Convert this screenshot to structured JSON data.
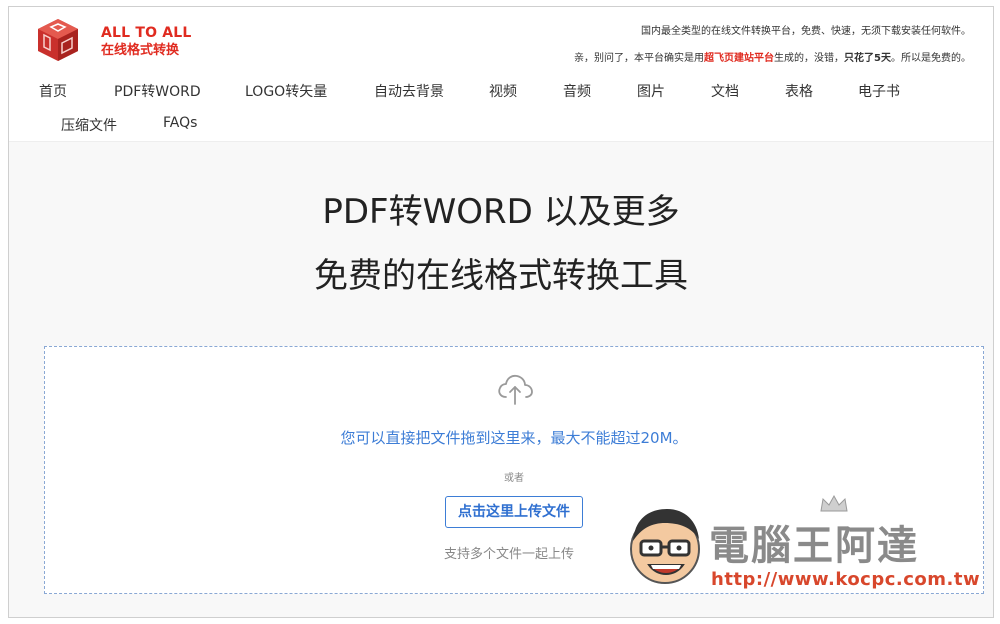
{
  "brand": {
    "name_en": "ALL TO ALL",
    "name_cn": "在线格式转换",
    "colors": {
      "accent": "#e02b20",
      "primary": "#3d7dd6"
    }
  },
  "notice": {
    "line1": "国内最全类型的在线文件转换平台，免费、快速，无须下载安装任何软件。",
    "line2_prefix": "亲，别问了，本平台确实是用",
    "line2_highlight": "超飞页建站平台",
    "line2_mid": "生成的，没错，",
    "line2_bold": "只花了5天",
    "line2_suffix": "。所以是免费的。"
  },
  "nav": {
    "items": [
      "首页",
      "PDF转WORD",
      "LOGO转矢量",
      "自动去背景",
      "视频",
      "音频",
      "图片",
      "文档",
      "表格",
      "电子书",
      "压缩文件",
      "FAQs"
    ]
  },
  "hero": {
    "title_line1": "PDF转WORD 以及更多",
    "title_line2": "免费的在线格式转换工具"
  },
  "upload": {
    "icon": "cloud-upload-icon",
    "drop_text": "您可以直接把文件拖到这里来，最大不能超过20M。",
    "or_text": "或者",
    "button_label": "点击这里上传文件",
    "multi_text": "支持多个文件一起上传"
  },
  "watermark": {
    "title": "電腦王阿達",
    "url": "http://www.kocpc.com.tw"
  }
}
